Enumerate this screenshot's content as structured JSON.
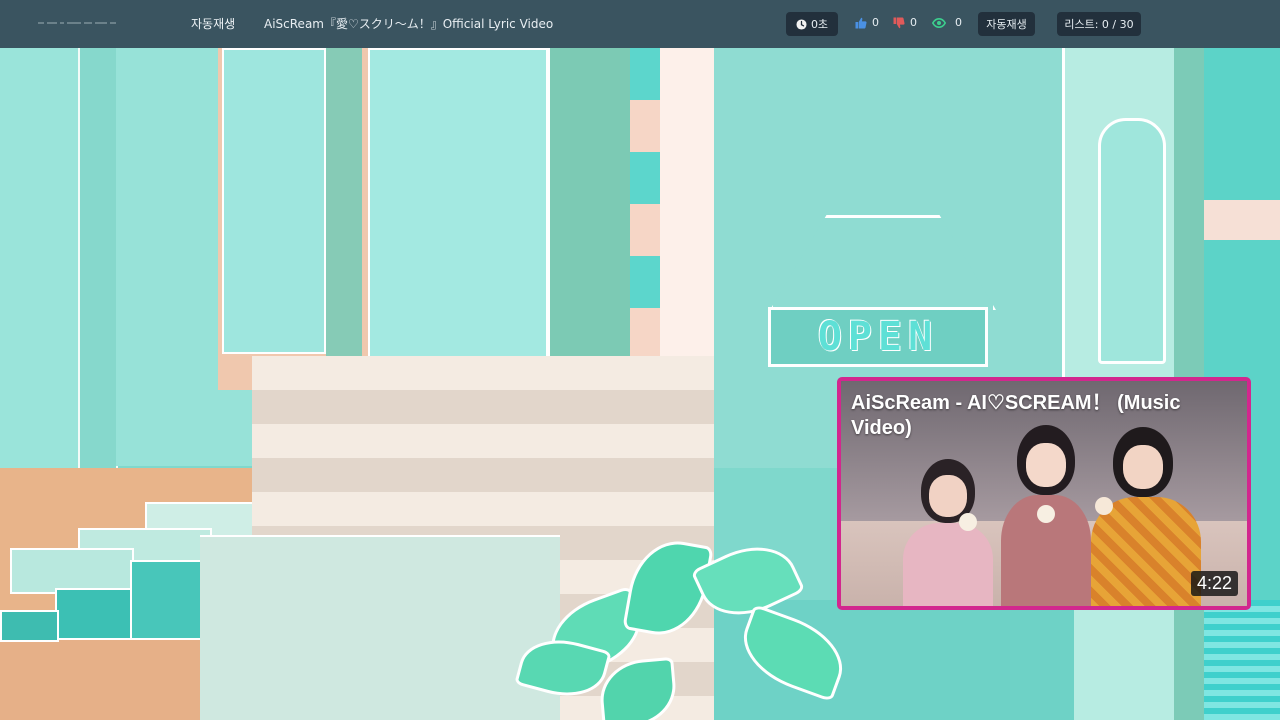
{
  "header": {
    "autoplay_link": "자동재생",
    "now_playing_title": "AiScReam『愛♡スクリ～ム！』Official Lyric Video",
    "elapsed": "0초",
    "likes": "0",
    "dislikes": "0",
    "views": "0",
    "autoplay_button": "자동재생",
    "list_counter": "리스트: 0 / 30"
  },
  "scene": {
    "sign_text": "OPEN"
  },
  "recommendation": {
    "title": "AiScReam - AI♡SCREAM！ (Music Video)",
    "duration": "4:22"
  },
  "colors": {
    "accent_border": "#d2278e",
    "header_bg": "#2e3e4e",
    "scene_teal": "#8fe0d6",
    "like_blue": "#4a90e2",
    "dislike_red": "#e05a5a",
    "views_green": "#3ccf8e"
  },
  "icons": {
    "clock": "clock-icon",
    "like": "thumbs-up-icon",
    "dislike": "thumbs-down-icon",
    "views": "eye-icon"
  }
}
